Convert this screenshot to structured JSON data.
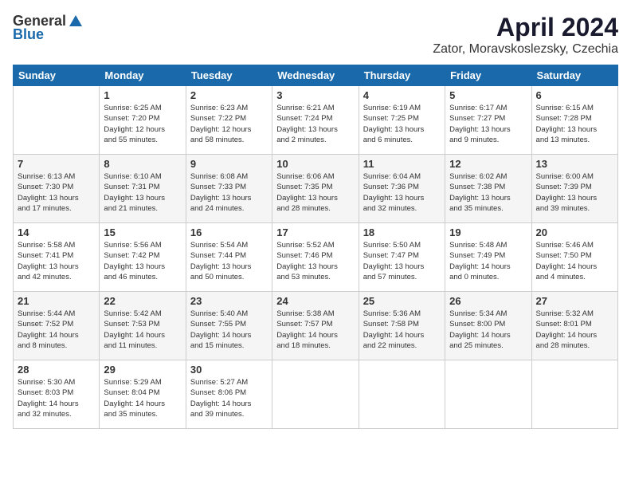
{
  "header": {
    "logo_general": "General",
    "logo_blue": "Blue",
    "month_title": "April 2024",
    "location": "Zator, Moravskoslezsky, Czechia"
  },
  "weekdays": [
    "Sunday",
    "Monday",
    "Tuesday",
    "Wednesday",
    "Thursday",
    "Friday",
    "Saturday"
  ],
  "weeks": [
    [
      {
        "day": "",
        "info": ""
      },
      {
        "day": "1",
        "info": "Sunrise: 6:25 AM\nSunset: 7:20 PM\nDaylight: 12 hours\nand 55 minutes."
      },
      {
        "day": "2",
        "info": "Sunrise: 6:23 AM\nSunset: 7:22 PM\nDaylight: 12 hours\nand 58 minutes."
      },
      {
        "day": "3",
        "info": "Sunrise: 6:21 AM\nSunset: 7:24 PM\nDaylight: 13 hours\nand 2 minutes."
      },
      {
        "day": "4",
        "info": "Sunrise: 6:19 AM\nSunset: 7:25 PM\nDaylight: 13 hours\nand 6 minutes."
      },
      {
        "day": "5",
        "info": "Sunrise: 6:17 AM\nSunset: 7:27 PM\nDaylight: 13 hours\nand 9 minutes."
      },
      {
        "day": "6",
        "info": "Sunrise: 6:15 AM\nSunset: 7:28 PM\nDaylight: 13 hours\nand 13 minutes."
      }
    ],
    [
      {
        "day": "7",
        "info": "Sunrise: 6:13 AM\nSunset: 7:30 PM\nDaylight: 13 hours\nand 17 minutes."
      },
      {
        "day": "8",
        "info": "Sunrise: 6:10 AM\nSunset: 7:31 PM\nDaylight: 13 hours\nand 21 minutes."
      },
      {
        "day": "9",
        "info": "Sunrise: 6:08 AM\nSunset: 7:33 PM\nDaylight: 13 hours\nand 24 minutes."
      },
      {
        "day": "10",
        "info": "Sunrise: 6:06 AM\nSunset: 7:35 PM\nDaylight: 13 hours\nand 28 minutes."
      },
      {
        "day": "11",
        "info": "Sunrise: 6:04 AM\nSunset: 7:36 PM\nDaylight: 13 hours\nand 32 minutes."
      },
      {
        "day": "12",
        "info": "Sunrise: 6:02 AM\nSunset: 7:38 PM\nDaylight: 13 hours\nand 35 minutes."
      },
      {
        "day": "13",
        "info": "Sunrise: 6:00 AM\nSunset: 7:39 PM\nDaylight: 13 hours\nand 39 minutes."
      }
    ],
    [
      {
        "day": "14",
        "info": "Sunrise: 5:58 AM\nSunset: 7:41 PM\nDaylight: 13 hours\nand 42 minutes."
      },
      {
        "day": "15",
        "info": "Sunrise: 5:56 AM\nSunset: 7:42 PM\nDaylight: 13 hours\nand 46 minutes."
      },
      {
        "day": "16",
        "info": "Sunrise: 5:54 AM\nSunset: 7:44 PM\nDaylight: 13 hours\nand 50 minutes."
      },
      {
        "day": "17",
        "info": "Sunrise: 5:52 AM\nSunset: 7:46 PM\nDaylight: 13 hours\nand 53 minutes."
      },
      {
        "day": "18",
        "info": "Sunrise: 5:50 AM\nSunset: 7:47 PM\nDaylight: 13 hours\nand 57 minutes."
      },
      {
        "day": "19",
        "info": "Sunrise: 5:48 AM\nSunset: 7:49 PM\nDaylight: 14 hours\nand 0 minutes."
      },
      {
        "day": "20",
        "info": "Sunrise: 5:46 AM\nSunset: 7:50 PM\nDaylight: 14 hours\nand 4 minutes."
      }
    ],
    [
      {
        "day": "21",
        "info": "Sunrise: 5:44 AM\nSunset: 7:52 PM\nDaylight: 14 hours\nand 8 minutes."
      },
      {
        "day": "22",
        "info": "Sunrise: 5:42 AM\nSunset: 7:53 PM\nDaylight: 14 hours\nand 11 minutes."
      },
      {
        "day": "23",
        "info": "Sunrise: 5:40 AM\nSunset: 7:55 PM\nDaylight: 14 hours\nand 15 minutes."
      },
      {
        "day": "24",
        "info": "Sunrise: 5:38 AM\nSunset: 7:57 PM\nDaylight: 14 hours\nand 18 minutes."
      },
      {
        "day": "25",
        "info": "Sunrise: 5:36 AM\nSunset: 7:58 PM\nDaylight: 14 hours\nand 22 minutes."
      },
      {
        "day": "26",
        "info": "Sunrise: 5:34 AM\nSunset: 8:00 PM\nDaylight: 14 hours\nand 25 minutes."
      },
      {
        "day": "27",
        "info": "Sunrise: 5:32 AM\nSunset: 8:01 PM\nDaylight: 14 hours\nand 28 minutes."
      }
    ],
    [
      {
        "day": "28",
        "info": "Sunrise: 5:30 AM\nSunset: 8:03 PM\nDaylight: 14 hours\nand 32 minutes."
      },
      {
        "day": "29",
        "info": "Sunrise: 5:29 AM\nSunset: 8:04 PM\nDaylight: 14 hours\nand 35 minutes."
      },
      {
        "day": "30",
        "info": "Sunrise: 5:27 AM\nSunset: 8:06 PM\nDaylight: 14 hours\nand 39 minutes."
      },
      {
        "day": "",
        "info": ""
      },
      {
        "day": "",
        "info": ""
      },
      {
        "day": "",
        "info": ""
      },
      {
        "day": "",
        "info": ""
      }
    ]
  ]
}
